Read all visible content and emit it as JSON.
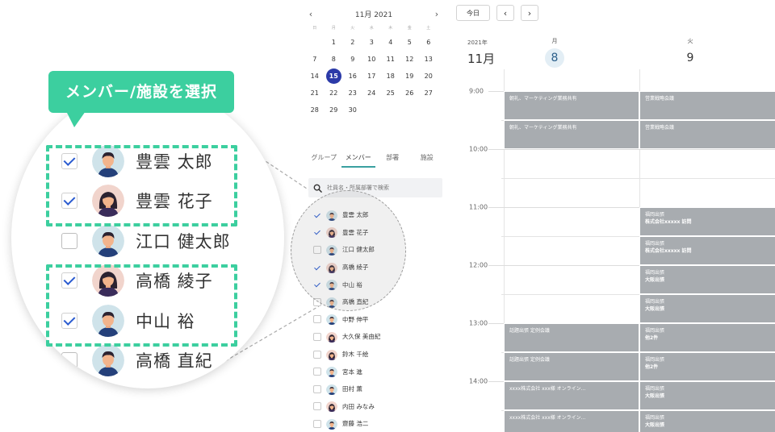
{
  "mini_calendar": {
    "title": "11月 2021",
    "prev": "‹",
    "next": "›",
    "dow": [
      "日",
      "月",
      "火",
      "水",
      "木",
      "金",
      "土"
    ],
    "weeks": [
      [
        "",
        "1",
        "2",
        "3",
        "4",
        "5",
        "6"
      ],
      [
        "7",
        "8",
        "9",
        "10",
        "11",
        "12",
        "13"
      ],
      [
        "14",
        "15",
        "16",
        "17",
        "18",
        "19",
        "20"
      ],
      [
        "21",
        "22",
        "23",
        "24",
        "25",
        "26",
        "27"
      ],
      [
        "28",
        "29",
        "30",
        "",
        "",
        "",
        ""
      ]
    ],
    "selected": "15",
    "selected_color": "#2b3aa8"
  },
  "tabs": [
    "グループ",
    "メンバー",
    "部署",
    "施設"
  ],
  "active_tab": "メンバー",
  "search": {
    "placeholder": "社員名・所属部署で検索"
  },
  "members": [
    {
      "name": "豊雲 太郎",
      "checked": true,
      "avatar": "man"
    },
    {
      "name": "豊雲 花子",
      "checked": true,
      "avatar": "woman"
    },
    {
      "name": "江口 健太郎",
      "checked": false,
      "avatar": "man"
    },
    {
      "name": "高橋 綾子",
      "checked": true,
      "avatar": "woman"
    },
    {
      "name": "中山 裕",
      "checked": true,
      "avatar": "man"
    },
    {
      "name": "高橋 直紀",
      "checked": false,
      "avatar": "man"
    },
    {
      "name": "中野 伸平",
      "checked": false,
      "avatar": "man"
    },
    {
      "name": "大久保 美由紀",
      "checked": false,
      "avatar": "woman"
    },
    {
      "name": "鈴木 千絵",
      "checked": false,
      "avatar": "woman"
    },
    {
      "name": "宮本 進",
      "checked": false,
      "avatar": "man"
    },
    {
      "name": "田村 薫",
      "checked": false,
      "avatar": "man"
    },
    {
      "name": "内田 みなみ",
      "checked": false,
      "avatar": "woman"
    },
    {
      "name": "齋藤 浩二",
      "checked": false,
      "avatar": "man"
    }
  ],
  "callout": "メンバー/施設を選択",
  "zoom_members": [
    {
      "name": "豊雲 太郎",
      "checked": true,
      "avatar": "man"
    },
    {
      "name": "豊雲 花子",
      "checked": true,
      "avatar": "woman"
    },
    {
      "name": "江口 健太郎",
      "checked": false,
      "avatar": "man"
    },
    {
      "name": "高橋 綾子",
      "checked": true,
      "avatar": "woman"
    },
    {
      "name": "中山 裕",
      "checked": true,
      "avatar": "man"
    },
    {
      "name": "高橋 直紀",
      "checked": false,
      "avatar": "man"
    }
  ],
  "toolbar": {
    "today": "今日",
    "prev": "‹",
    "next": "›"
  },
  "week_header": {
    "year": "2021年",
    "month": "11月",
    "days": [
      {
        "dow": "月",
        "num": "8",
        "today": true
      },
      {
        "dow": "火",
        "num": "9",
        "today": false
      }
    ]
  },
  "time_labels": [
    "9:00",
    "10:00",
    "11:00",
    "12:00",
    "13:00",
    "14:00"
  ],
  "events": {
    "col1": [
      {
        "title": "朝礼、マーケティング業務共有",
        "slot": 0
      },
      {
        "title": "朝礼、マーケティング業務共有",
        "slot": 1
      },
      {
        "title": "話題出張 定例会議",
        "slot": 8
      },
      {
        "title": "話題出張 定例会議",
        "slot": 9
      },
      {
        "title": "xxxx株式会社 xxx様 オンライン...",
        "slot": 10
      },
      {
        "title": "xxxx株式会社 xxx様 オンライン...",
        "slot": 11
      }
    ],
    "col2": [
      {
        "title": "営業戦略会議",
        "sub": "",
        "slot": 0
      },
      {
        "title": "営業戦略会議",
        "sub": "",
        "slot": 1
      },
      {
        "title": "福岡出張",
        "sub": "株式会社xxxxx 訪問",
        "slot": 4
      },
      {
        "title": "福岡出張",
        "sub": "株式会社xxxxx 訪問",
        "slot": 5
      },
      {
        "title": "福岡出張",
        "sub": "大阪出張",
        "slot": 6
      },
      {
        "title": "福岡出張",
        "sub": "大阪出張",
        "slot": 7
      },
      {
        "title": "福岡出張",
        "sub": "他2件",
        "slot": 8
      },
      {
        "title": "福岡出張",
        "sub": "他2件",
        "slot": 9
      },
      {
        "title": "福岡出張",
        "sub": "大阪出張",
        "slot": 10
      },
      {
        "title": "福岡出張",
        "sub": "大阪出張",
        "slot": 11
      }
    ]
  },
  "colors": {
    "accent_green": "#3ccf9f",
    "event_gray": "#a8acb0",
    "check_blue": "#2a5bd0"
  }
}
